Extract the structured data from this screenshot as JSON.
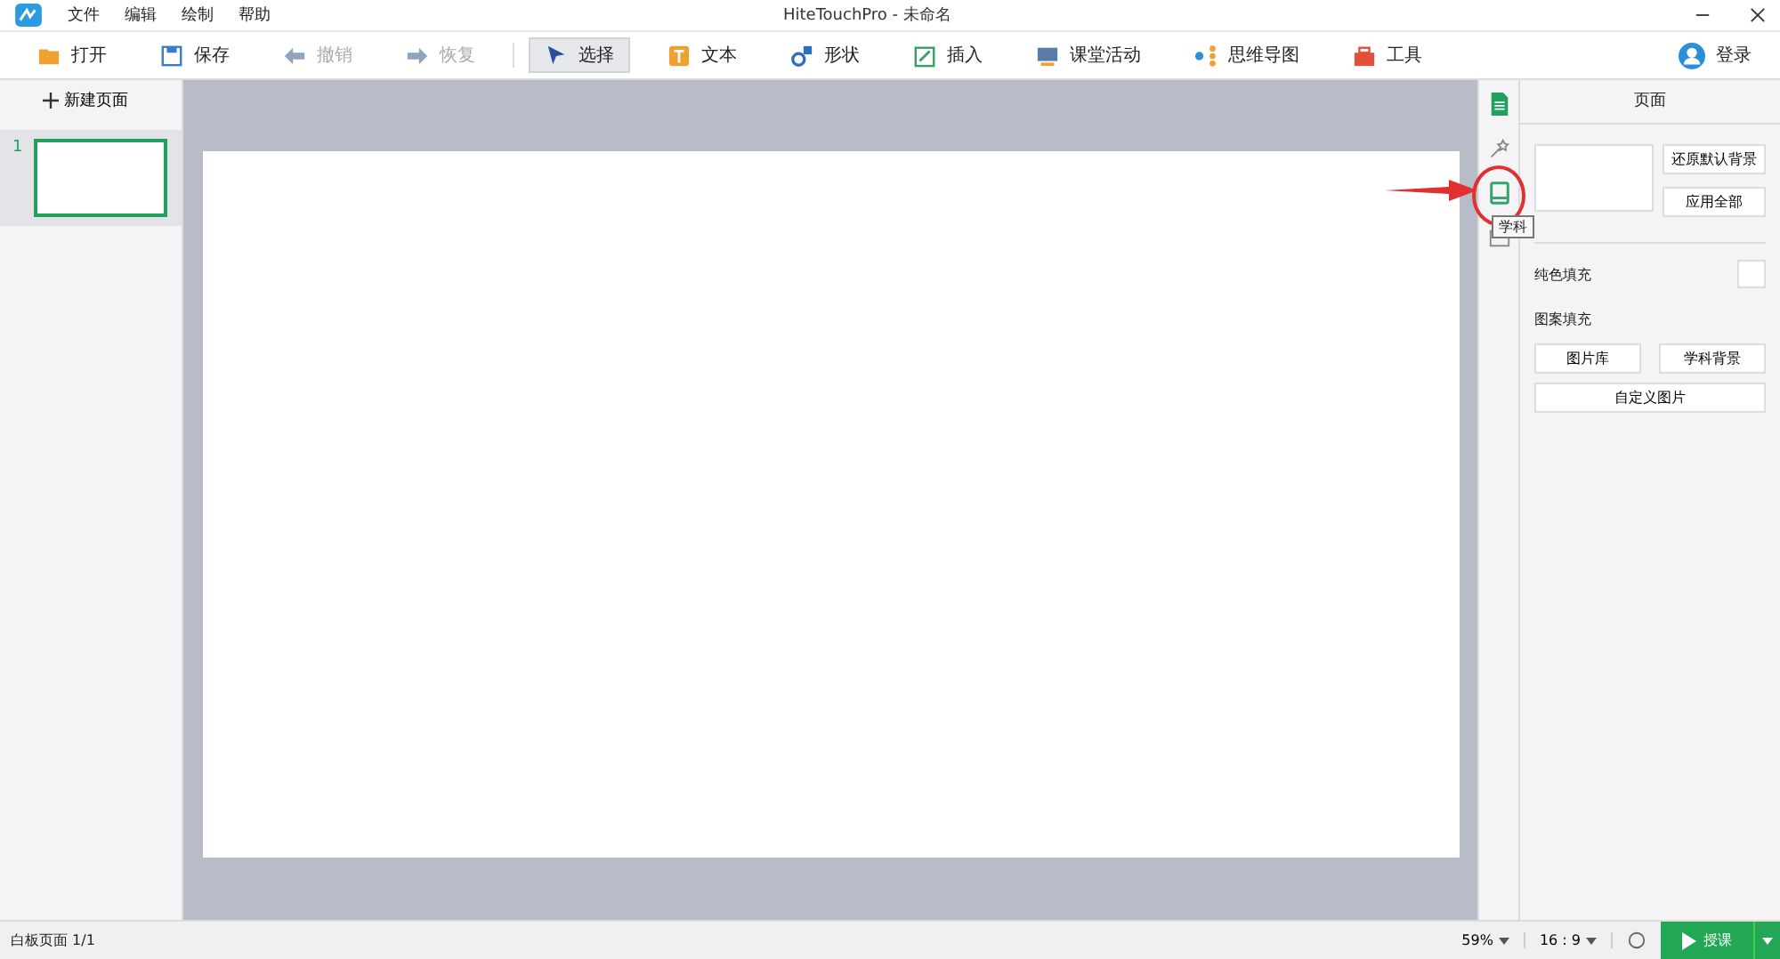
{
  "window": {
    "title": "HiteTouchPro - 未命名"
  },
  "menu": [
    "文件",
    "编辑",
    "绘制",
    "帮助"
  ],
  "toolbar": [
    {
      "label": "打开",
      "disabled": false,
      "selected": false
    },
    {
      "label": "保存",
      "disabled": false,
      "selected": false
    },
    {
      "label": "撤销",
      "disabled": true,
      "selected": false
    },
    {
      "label": "恢复",
      "disabled": true,
      "selected": false
    },
    {
      "label": "选择",
      "disabled": false,
      "selected": true
    },
    {
      "label": "文本",
      "disabled": false,
      "selected": false
    },
    {
      "label": "形状",
      "disabled": false,
      "selected": false
    },
    {
      "label": "插入",
      "disabled": false,
      "selected": false
    },
    {
      "label": "课堂活动",
      "disabled": false,
      "selected": false
    },
    {
      "label": "思维导图",
      "disabled": false,
      "selected": false
    },
    {
      "label": "工具",
      "disabled": false,
      "selected": false
    }
  ],
  "login": "登录",
  "sidebar": {
    "new_page": "新建页面",
    "pages": [
      {
        "number": "1",
        "selected": true
      }
    ]
  },
  "side_tabs": [
    {
      "selected": true
    },
    {
      "selected": false
    },
    {
      "selected": false
    },
    {
      "selected": false
    }
  ],
  "tooltip": "学科",
  "panel": {
    "title": "页面",
    "reset": "还原默认背景",
    "apply_all": "应用全部",
    "solid_fill": "纯色填充",
    "pattern_fill": "图案填充",
    "library": "图片库",
    "subject_bg": "学科背景",
    "custom": "自定义图片"
  },
  "status_bar": {
    "page": "白板页面 1/1",
    "zoom": "59%",
    "ratio": "16 : 9",
    "teach": "授课"
  }
}
